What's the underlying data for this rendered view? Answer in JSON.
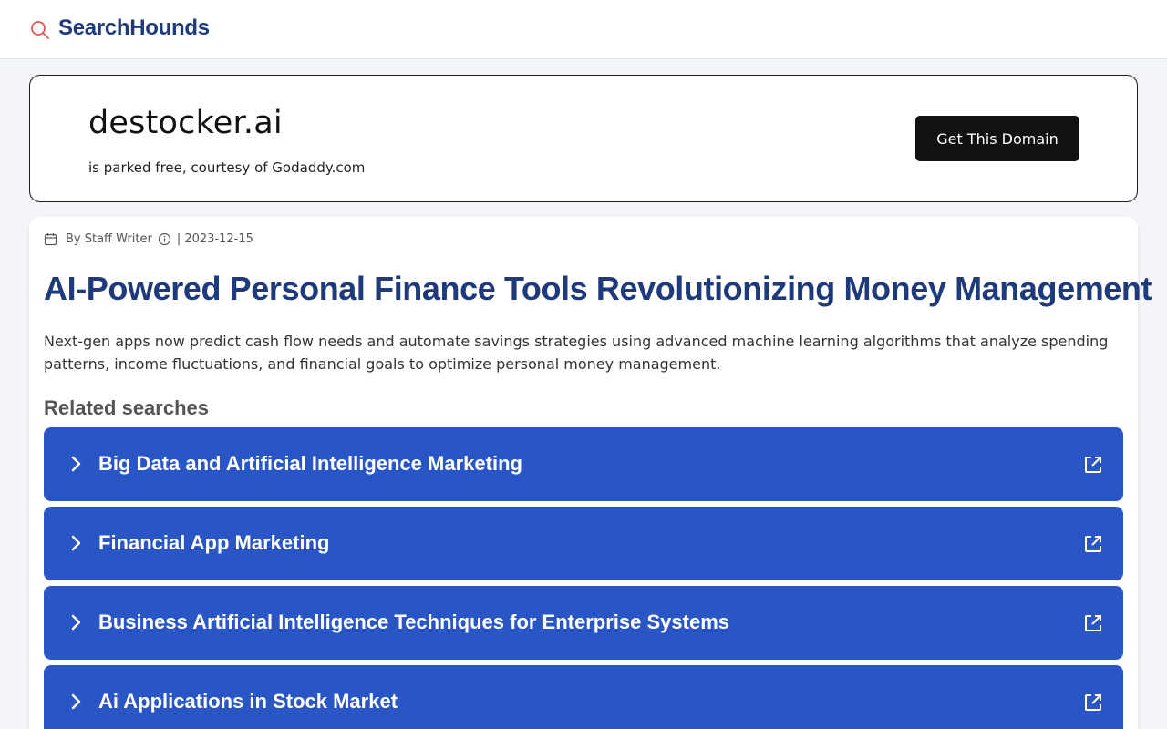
{
  "header": {
    "brand": "SearchHounds",
    "logo_icon": "search-icon",
    "accent_color": "#e05a4f",
    "brand_color": "#1e3a7b"
  },
  "domain_card": {
    "domain": "destocker.ai",
    "subtitle": "is parked free, courtesy of Godaddy.com",
    "cta_label": "Get This Domain"
  },
  "article": {
    "author": "By Staff Writer",
    "date_text": "| 2023-12-15",
    "title": "AI-Powered Personal Finance Tools Revolutionizing Money Management",
    "summary": "Next-gen apps now predict cash flow needs and automate savings strategies using advanced machine learning algorithms that analyze spending patterns, income fluctuations, and financial goals to optimize personal money management.",
    "related_heading": "Related searches"
  },
  "related_searches": [
    {
      "label": "Big Data and Artificial Intelligence Marketing"
    },
    {
      "label": "Financial App Marketing"
    },
    {
      "label": "Business Artificial Intelligence Techniques for Enterprise Systems"
    },
    {
      "label": "Ai Applications in Stock Market"
    }
  ],
  "colors": {
    "search_item_bg": "#2a55c4",
    "button_bg": "#111111"
  }
}
